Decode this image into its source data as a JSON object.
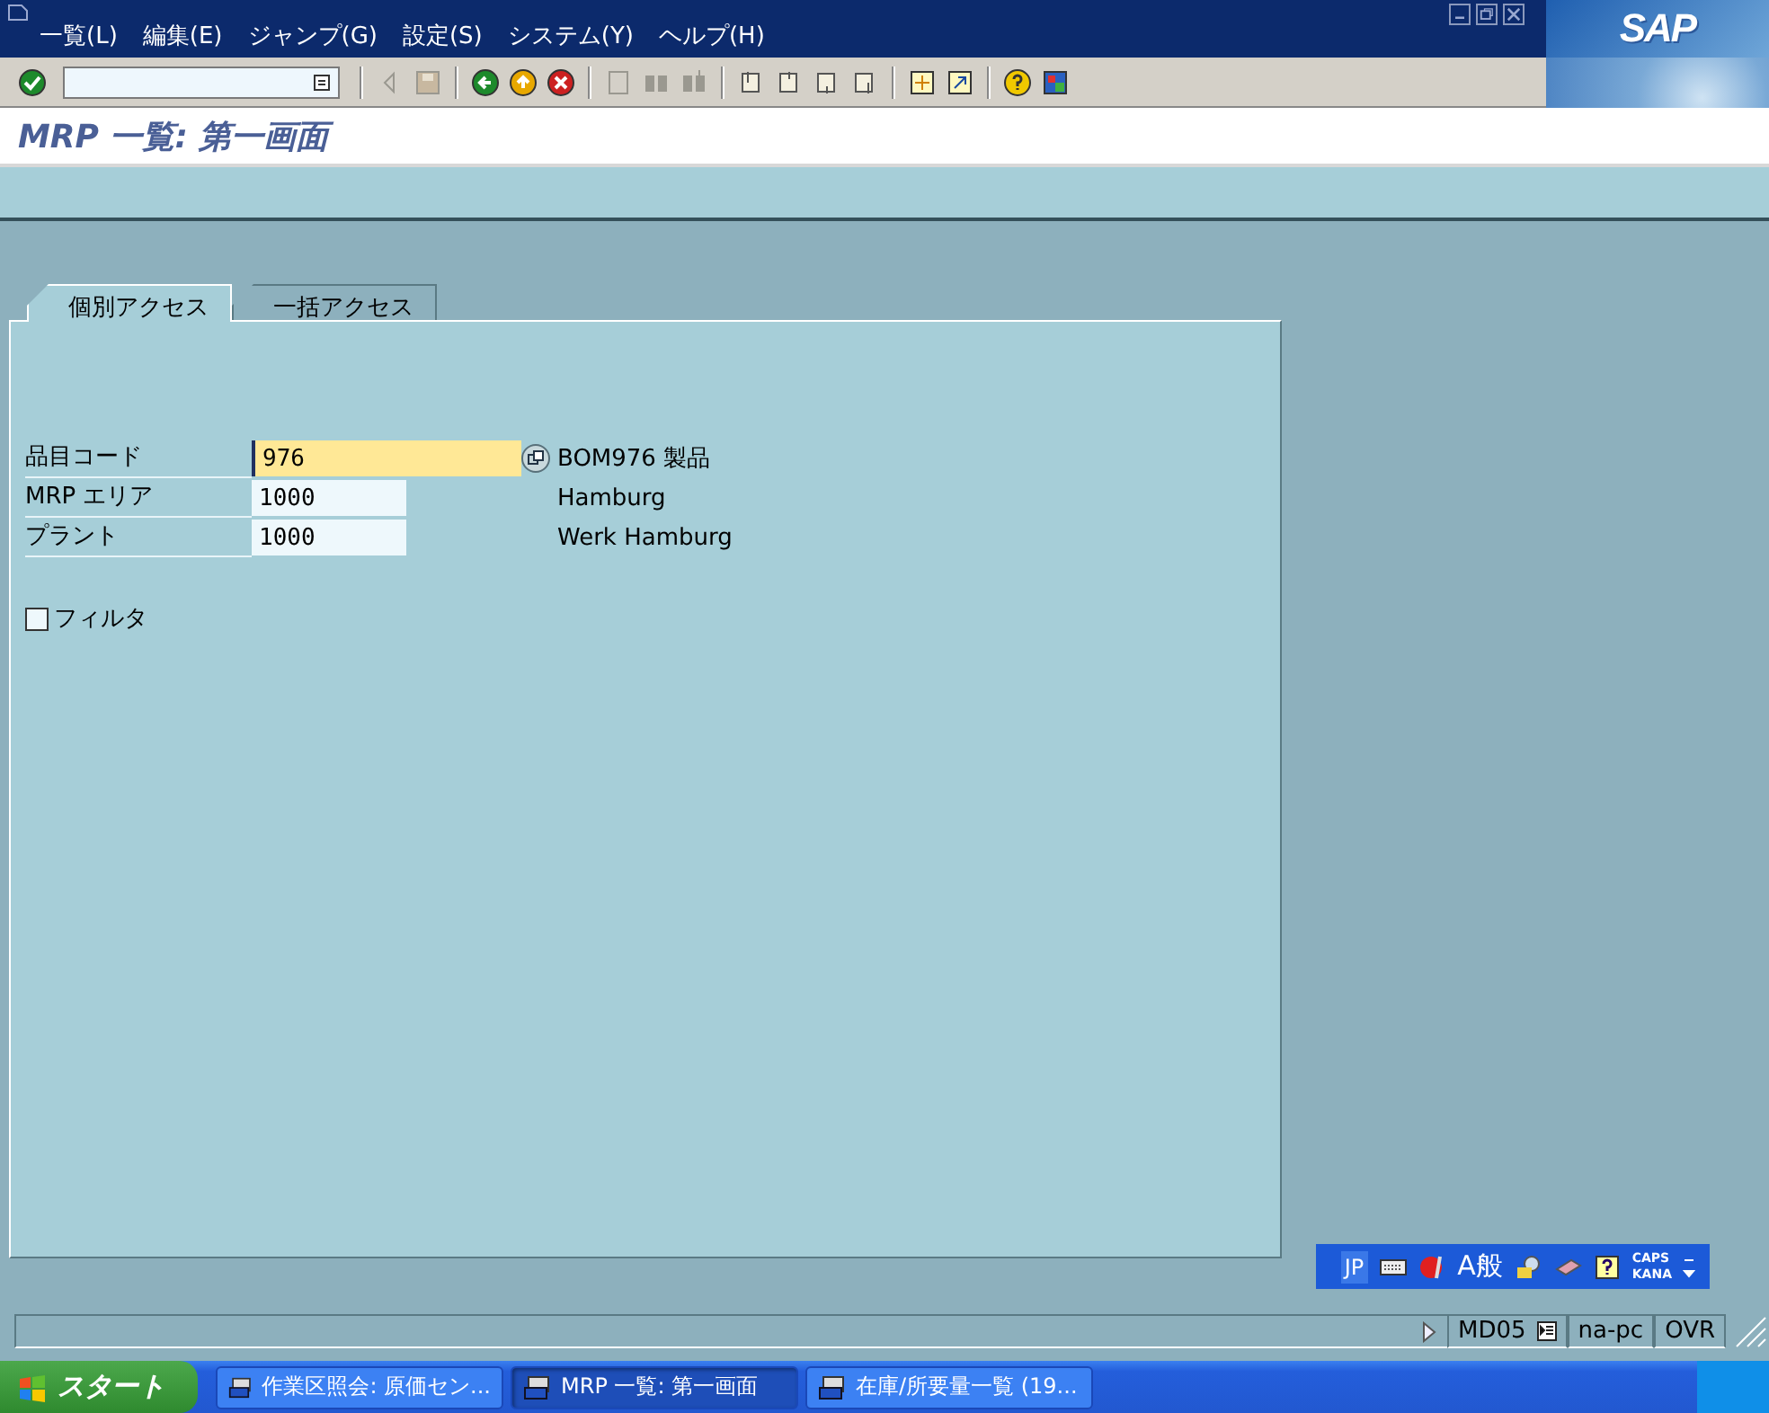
{
  "menu": [
    {
      "label": "一覧(L)"
    },
    {
      "label": "編集(E)"
    },
    {
      "label": "ジャンプ(G)"
    },
    {
      "label": "設定(S)"
    },
    {
      "label": "システム(Y)"
    },
    {
      "label": "ヘルプ(H)"
    }
  ],
  "logo": "SAP",
  "title": "MRP 一覧: 第一画面",
  "tabs": [
    {
      "label": "個別アクセス",
      "selected": true
    },
    {
      "label": "一括アクセス",
      "selected": false
    }
  ],
  "fields": [
    {
      "label": "品目コード",
      "value": "976",
      "description": "BOM976 製品",
      "focused": true
    },
    {
      "label": "MRP エリア",
      "value": "1000",
      "description": "Hamburg",
      "focused": false
    },
    {
      "label": "プラント",
      "value": "1000",
      "description": "Werk Hamburg",
      "focused": false
    }
  ],
  "filter": {
    "label": "フィルタ",
    "checked": false
  },
  "ime": {
    "mode": "JP",
    "input": "A般",
    "caps": "CAPS",
    "kana": "KANA"
  },
  "status": {
    "transaction": "MD05",
    "server": "na-pc",
    "mode": "OVR"
  },
  "taskbar": {
    "start": "スタート",
    "tasks": [
      {
        "label": "作業区照会: 原価セン...",
        "selected": false
      },
      {
        "label": "MRP 一覧: 第一画面",
        "selected": true
      },
      {
        "label": "在庫/所要量一覧 (19...",
        "selected": false
      }
    ]
  }
}
